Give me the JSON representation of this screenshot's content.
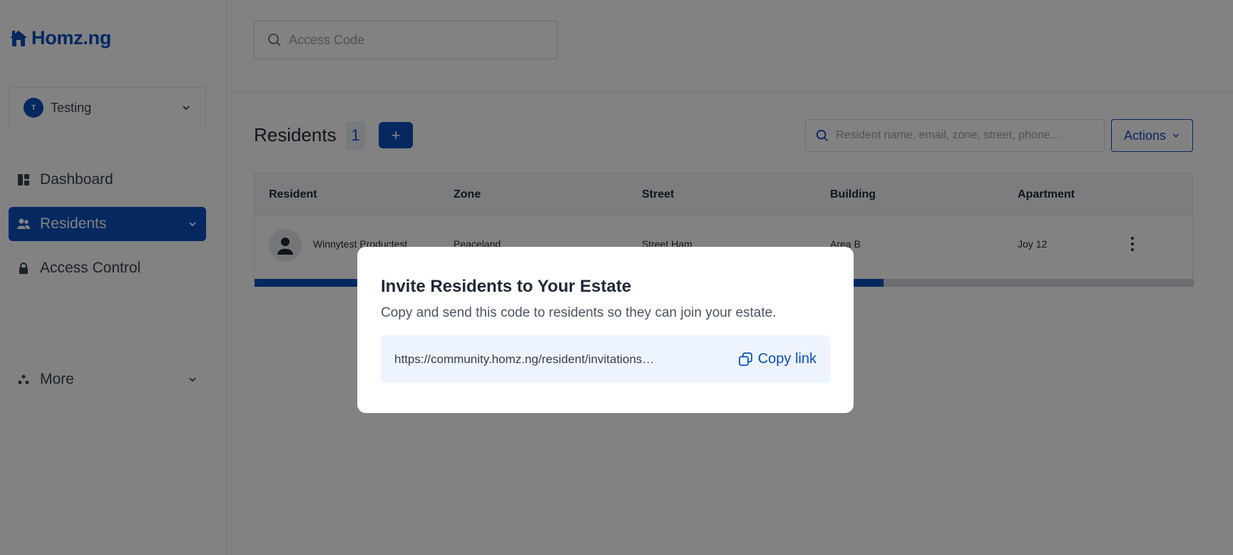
{
  "brand": {
    "name": "Homz.ng",
    "color": "#0b4fbf"
  },
  "sidebar": {
    "estate": {
      "initial": "T",
      "name": "Testing"
    },
    "items": [
      {
        "label": "Dashboard",
        "icon": "dashboard-icon"
      },
      {
        "label": "Residents",
        "icon": "users-icon",
        "active": true
      },
      {
        "label": "Access Control",
        "icon": "lock-icon"
      },
      {
        "label": "More",
        "icon": "more-icon"
      }
    ]
  },
  "topbar": {
    "access_placeholder": "Access Code"
  },
  "residents": {
    "title": "Residents",
    "count": "1",
    "add_label": "+",
    "search_placeholder": "Resident name, email, zone, street, phone...",
    "actions_label": "Actions",
    "columns": [
      "Resident",
      "Zone",
      "Street",
      "Building",
      "Apartment"
    ],
    "rows": [
      {
        "name": "Winnytest Productest",
        "zone": "Peaceland",
        "street": "Street Ham",
        "building": "Area B",
        "apartment": "Joy 12"
      }
    ],
    "scroll_fraction": 0.67
  },
  "modal": {
    "title": "Invite Residents to Your Estate",
    "description": "Copy and send this code to residents so they can join your estate.",
    "link": "https://community.homz.ng/resident/invitations…",
    "copy_label": "Copy link"
  }
}
